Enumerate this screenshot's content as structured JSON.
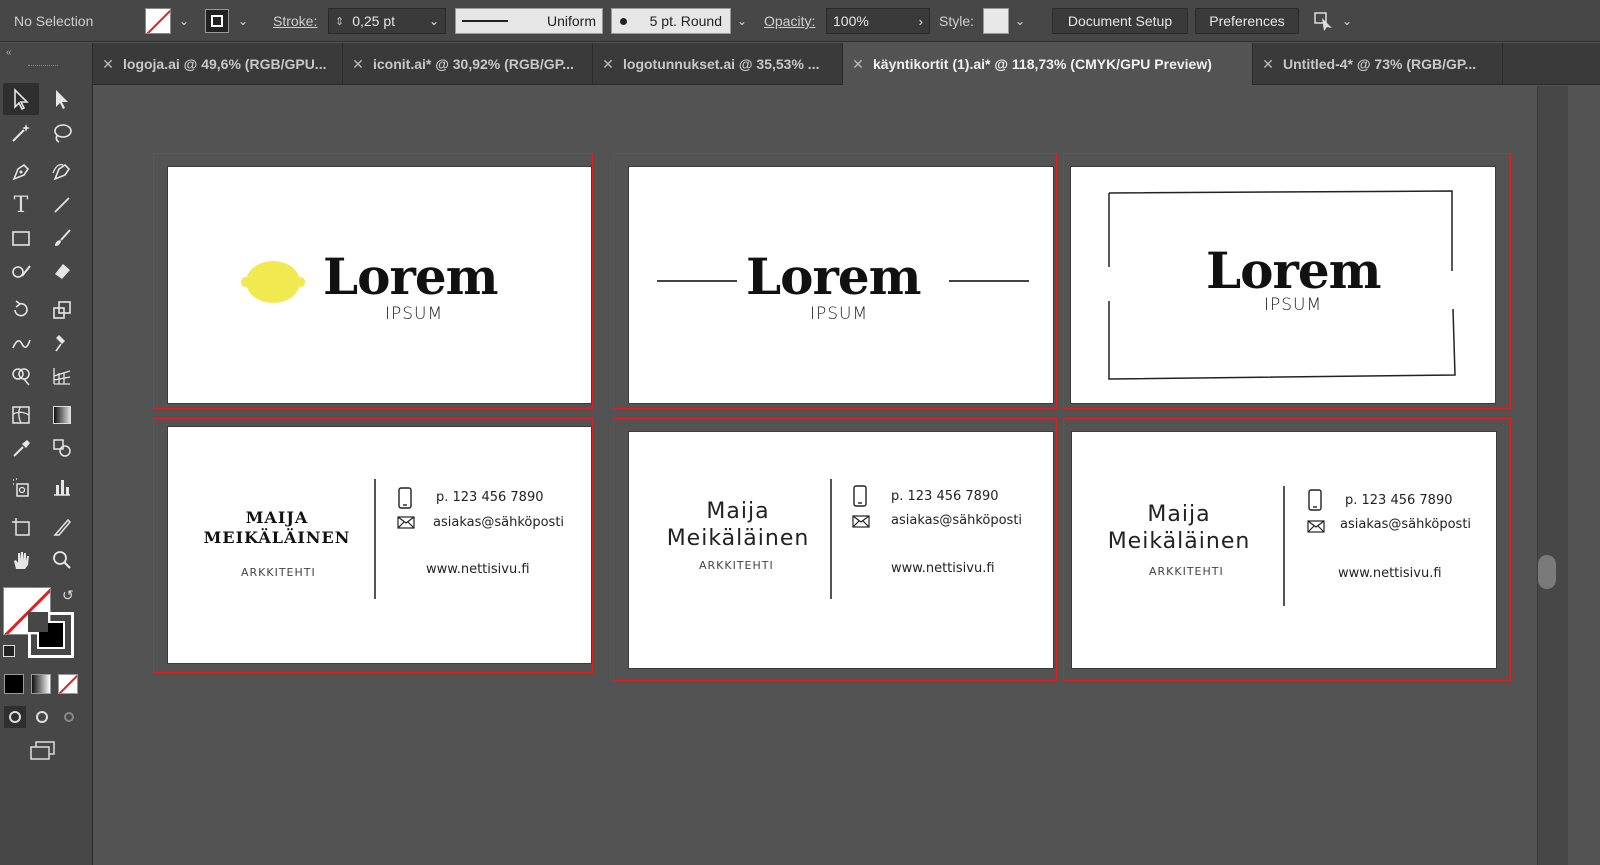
{
  "control_bar": {
    "selection_label": "No Selection",
    "stroke_label": "Stroke:",
    "stroke_weight": "0,25 pt",
    "profile_label": "Uniform",
    "brush_label": "5 pt. Round",
    "opacity_label": "Opacity:",
    "opacity_value": "100%",
    "style_label": "Style:",
    "document_setup_label": "Document Setup",
    "preferences_label": "Preferences"
  },
  "tabs": [
    {
      "label": "logoja.ai @ 49,6% (RGB/GPU..."
    },
    {
      "label": "iconit.ai* @ 30,92% (RGB/GP..."
    },
    {
      "label": "logotunnukset.ai @ 35,53% ..."
    },
    {
      "label": "käyntikortit (1).ai* @ 118,73% (CMYK/GPU Preview)"
    },
    {
      "label": "Untitled-4* @ 73% (RGB/GP..."
    }
  ],
  "cards": {
    "logo_title": "Lorem",
    "logo_subtitle": "IPSUM",
    "name_caps_line1": "MAIJA",
    "name_caps_line2": "MEIKÄLÄINEN",
    "name_line1": "Maija",
    "name_line2": "Meikäläinen",
    "role": "ARKKITEHTI",
    "phone": "p. 123 456 7890",
    "email": "asiakas@sähköposti",
    "website": "www.nettisivu.fi"
  },
  "colors": {
    "artboard_border": "#e01e1e",
    "lemon": "#f0e94f",
    "ui_dark": "#474747",
    "canvas": "#535353"
  }
}
